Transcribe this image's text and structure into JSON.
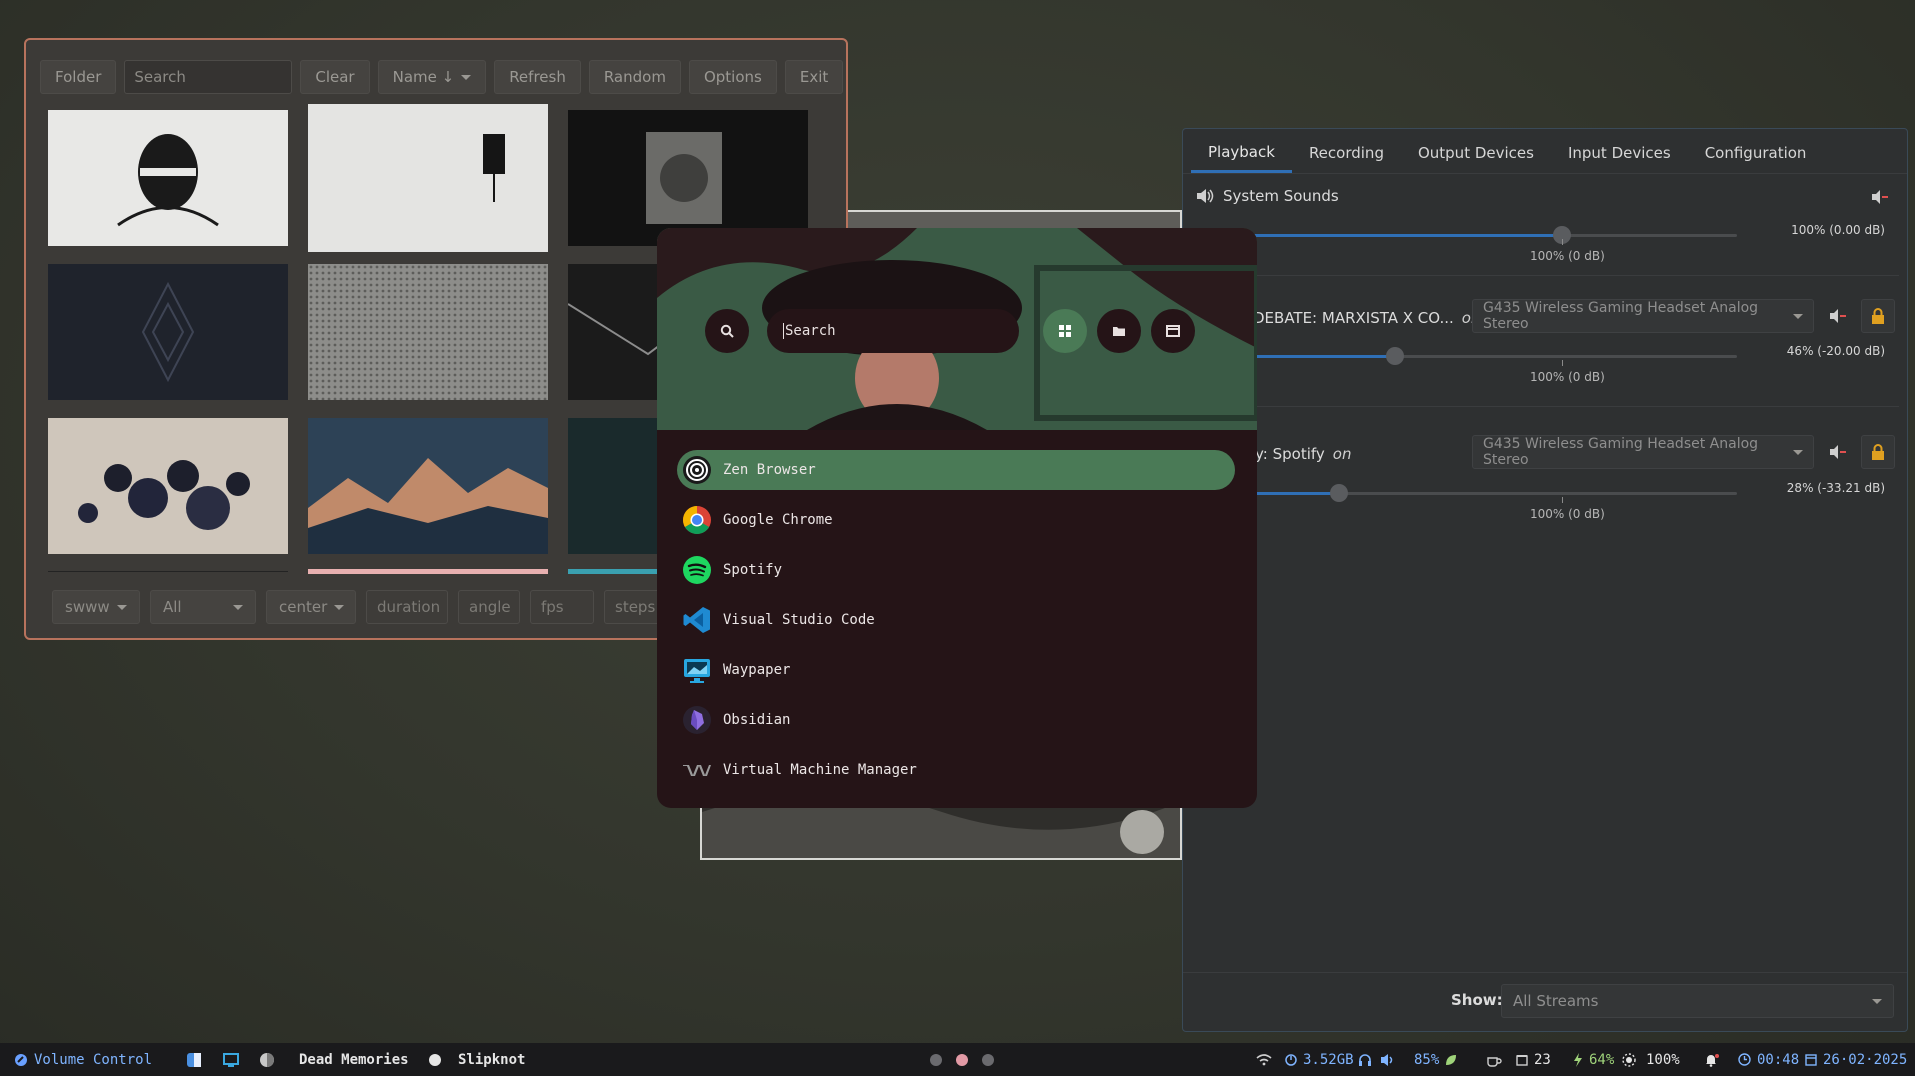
{
  "waypaper": {
    "toolbar": {
      "folder": "Folder",
      "search_placeholder": "Search",
      "clear": "Clear",
      "sort": "Name ↓",
      "refresh": "Refresh",
      "random": "Random",
      "options": "Options",
      "exit": "Exit"
    },
    "bottom": {
      "backend": "swww",
      "monitor": "All",
      "fill": "center",
      "duration": "duration",
      "angle": "angle",
      "fps": "fps",
      "steps": "steps"
    }
  },
  "launcher": {
    "search_value": "Search",
    "apps": [
      {
        "name": "Zen Browser",
        "icon": "zen-browser-icon"
      },
      {
        "name": "Google Chrome",
        "icon": "chrome-icon"
      },
      {
        "name": "Spotify",
        "icon": "spotify-icon"
      },
      {
        "name": "Visual Studio Code",
        "icon": "vscode-icon"
      },
      {
        "name": "Waypaper",
        "icon": "waypaper-icon"
      },
      {
        "name": "Obsidian",
        "icon": "obsidian-icon"
      },
      {
        "name": "Virtual Machine Manager",
        "icon": "virt-manager-icon"
      }
    ],
    "accent": "#4a7a56",
    "background": "#251417"
  },
  "volume": {
    "tabs": [
      "Playback",
      "Recording",
      "Output Devices",
      "Input Devices",
      "Configuration"
    ],
    "active_tab": "Playback",
    "streams": [
      {
        "name": "System Sounds",
        "value": "100% (0.00 dB)",
        "level": 1.0,
        "mark": "100% (0 dB)"
      },
      {
        "name": "DEBATE: MARXISTA X CO...",
        "on": "on",
        "device": "G435 Wireless Gaming Headset Analog Stereo",
        "value": "46% (-20.00 dB)",
        "level": 0.46,
        "mark": "100% (0 dB)"
      },
      {
        "name": "y: Spotify",
        "on": "on",
        "device": "G435 Wireless Gaming Headset Analog Stereo",
        "value": "28% (-33.21 dB)",
        "level": 0.28,
        "mark": "100% (0 dB)"
      }
    ],
    "show_label": "Show:",
    "show_value": "All Streams",
    "accent": "#2f6fb6"
  },
  "bar": {
    "window_title": "Volume Control",
    "track": "Dead Memories",
    "artist": "Slipknot",
    "memory": "3.52GB",
    "volume": "85%",
    "updates": "23",
    "battery": "64%",
    "brightness": "100%",
    "time": "00:48",
    "date": "26·02·2025",
    "workspaces": 3,
    "active_workspace": 2
  }
}
